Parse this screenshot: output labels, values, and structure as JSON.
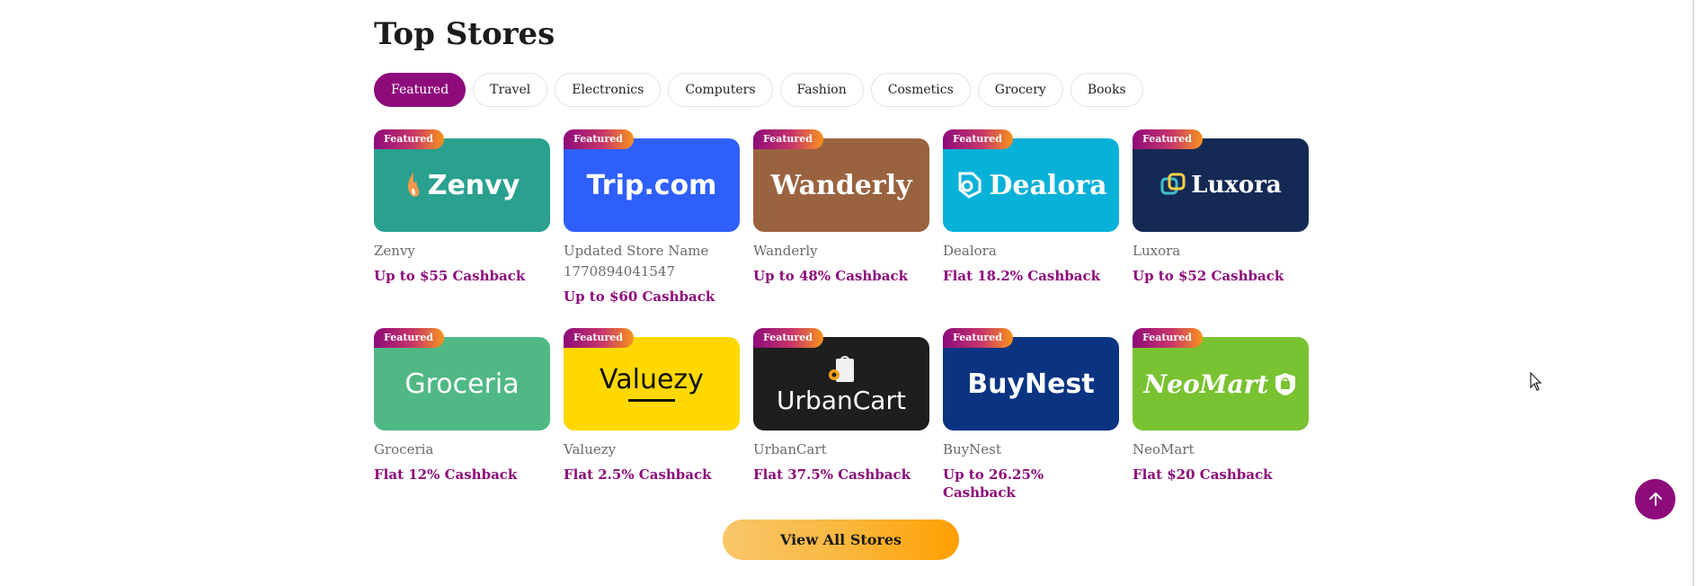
{
  "section": {
    "title": "Top Stores"
  },
  "tabs": [
    {
      "label": "Featured",
      "active": true
    },
    {
      "label": "Travel"
    },
    {
      "label": "Electronics"
    },
    {
      "label": "Computers"
    },
    {
      "label": "Fashion"
    },
    {
      "label": "Cosmetics"
    },
    {
      "label": "Grocery"
    },
    {
      "label": "Books"
    }
  ],
  "badge_label": "Featured",
  "stores": [
    {
      "logo_text": "Zenvy",
      "name": "Zenvy",
      "cashback": "Up to $55 Cashback",
      "bg": "#2aa08f",
      "logo_color": "#ffffff"
    },
    {
      "logo_text": "Trip.com",
      "name": "Updated Store Name 1770894041547",
      "cashback": "Up to $60 Cashback",
      "bg": "#2f5ffb",
      "logo_color": "#ffffff"
    },
    {
      "logo_text": "Wanderly",
      "name": "Wanderly",
      "cashback": "Up to 48% Cashback",
      "bg": "#9a6340",
      "logo_color": "#ffffff"
    },
    {
      "logo_text": "Dealora",
      "name": "Dealora",
      "cashback": "Flat 18.2% Cashback",
      "bg": "#08b1d8",
      "logo_color": "#ffffff"
    },
    {
      "logo_text": "Luxora",
      "name": "Luxora",
      "cashback": "Up to $52 Cashback",
      "bg": "#142a54",
      "logo_color": "#ffffff"
    },
    {
      "logo_text": "Groceria",
      "name": "Groceria",
      "cashback": "Flat 12% Cashback",
      "bg": "#50b885",
      "logo_color": "#ffffff"
    },
    {
      "logo_text": "Valuezy",
      "name": "Valuezy",
      "cashback": "Flat 2.5% Cashback",
      "bg": "#fed800",
      "logo_color": "#111111"
    },
    {
      "logo_text": "UrbanCart",
      "name": "UrbanCart",
      "cashback": "Flat 37.5% Cashback",
      "bg": "#1e1e1e",
      "logo_color": "#ffffff"
    },
    {
      "logo_text": "BuyNest",
      "name": "BuyNest",
      "cashback": "Up to 26.25% Cashback",
      "bg": "#0a3482",
      "logo_color": "#ffffff"
    },
    {
      "logo_text": "NeoMart",
      "name": "NeoMart",
      "cashback": "Flat $20 Cashback",
      "bg": "#79c231",
      "logo_color": "#ffffff"
    }
  ],
  "view_all": {
    "label": "View All Stores"
  },
  "colors": {
    "accent": "#8d0b7b",
    "button_gradient_start": "#f9c66a",
    "button_gradient_end": "#ff9f00"
  },
  "icons": {
    "scroll_top": "arrow-up-icon",
    "cursor": "mouse-pointer-icon"
  }
}
